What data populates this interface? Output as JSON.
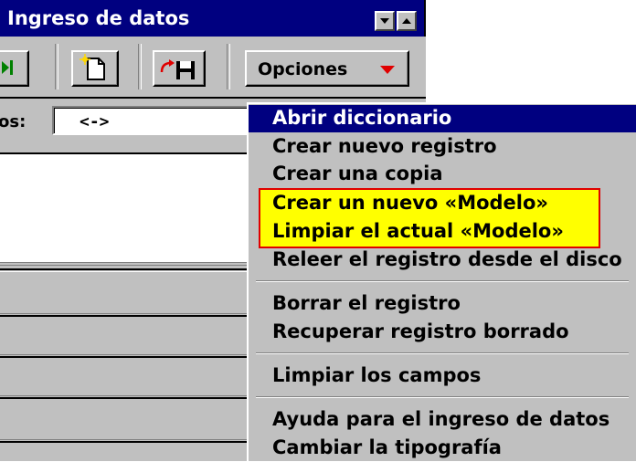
{
  "window": {
    "title": "Ingreso de datos"
  },
  "toolbar": {
    "options_label": "Opciones"
  },
  "field": {
    "label_partial": "os:",
    "value": "<->"
  },
  "menu": {
    "items": [
      "Abrir diccionario",
      "Crear nuevo registro",
      "Crear una copia",
      "Crear un nuevo «Modelo»",
      "Limpiar el actual «Modelo»",
      "Releer el registro desde el disco",
      "Borrar el registro",
      "Recuperar registro borrado",
      "Limpiar los campos",
      "Ayuda para el ingreso de datos",
      "Cambiar la tipografía"
    ],
    "selected_index": 0
  },
  "colors": {
    "titlebar": "#000080",
    "menu_selection": "#000080",
    "highlight_fill": "#ffff00",
    "highlight_border": "#e00000",
    "dropdown_arrow": "#e00000"
  }
}
